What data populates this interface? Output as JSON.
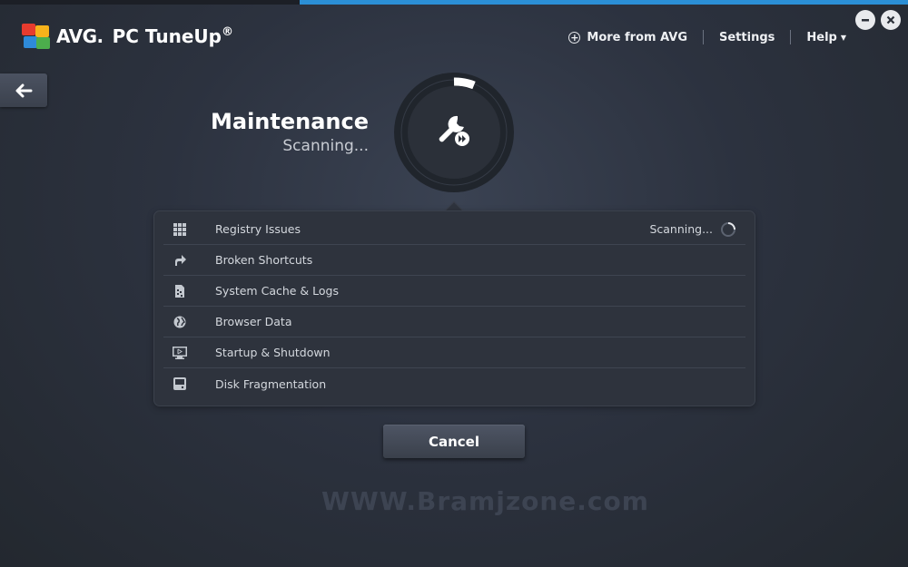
{
  "app": {
    "brand": "AVG.",
    "product": "PC TuneUp",
    "registered": "®"
  },
  "topnav": {
    "more_label": "More from AVG",
    "settings_label": "Settings",
    "help_label": "Help"
  },
  "header": {
    "title": "Maintenance",
    "status": "Scanning..."
  },
  "scan_items": [
    {
      "label": "Registry Issues",
      "status": "Scanning...",
      "icon": "grid-icon"
    },
    {
      "label": "Broken Shortcuts",
      "status": "",
      "icon": "shortcut-arrow-icon"
    },
    {
      "label": "System Cache & Logs",
      "status": "",
      "icon": "cache-file-icon"
    },
    {
      "label": "Browser Data",
      "status": "",
      "icon": "globe-icon"
    },
    {
      "label": "Startup & Shutdown",
      "status": "",
      "icon": "monitor-icon"
    },
    {
      "label": "Disk Fragmentation",
      "status": "",
      "icon": "disk-icon"
    }
  ],
  "actions": {
    "cancel_label": "Cancel"
  },
  "watermark": "WWW.Bramjzone.com",
  "colors": {
    "accent": "#2b8fd6",
    "background": "#2c323f",
    "panel": "#2e333d"
  }
}
